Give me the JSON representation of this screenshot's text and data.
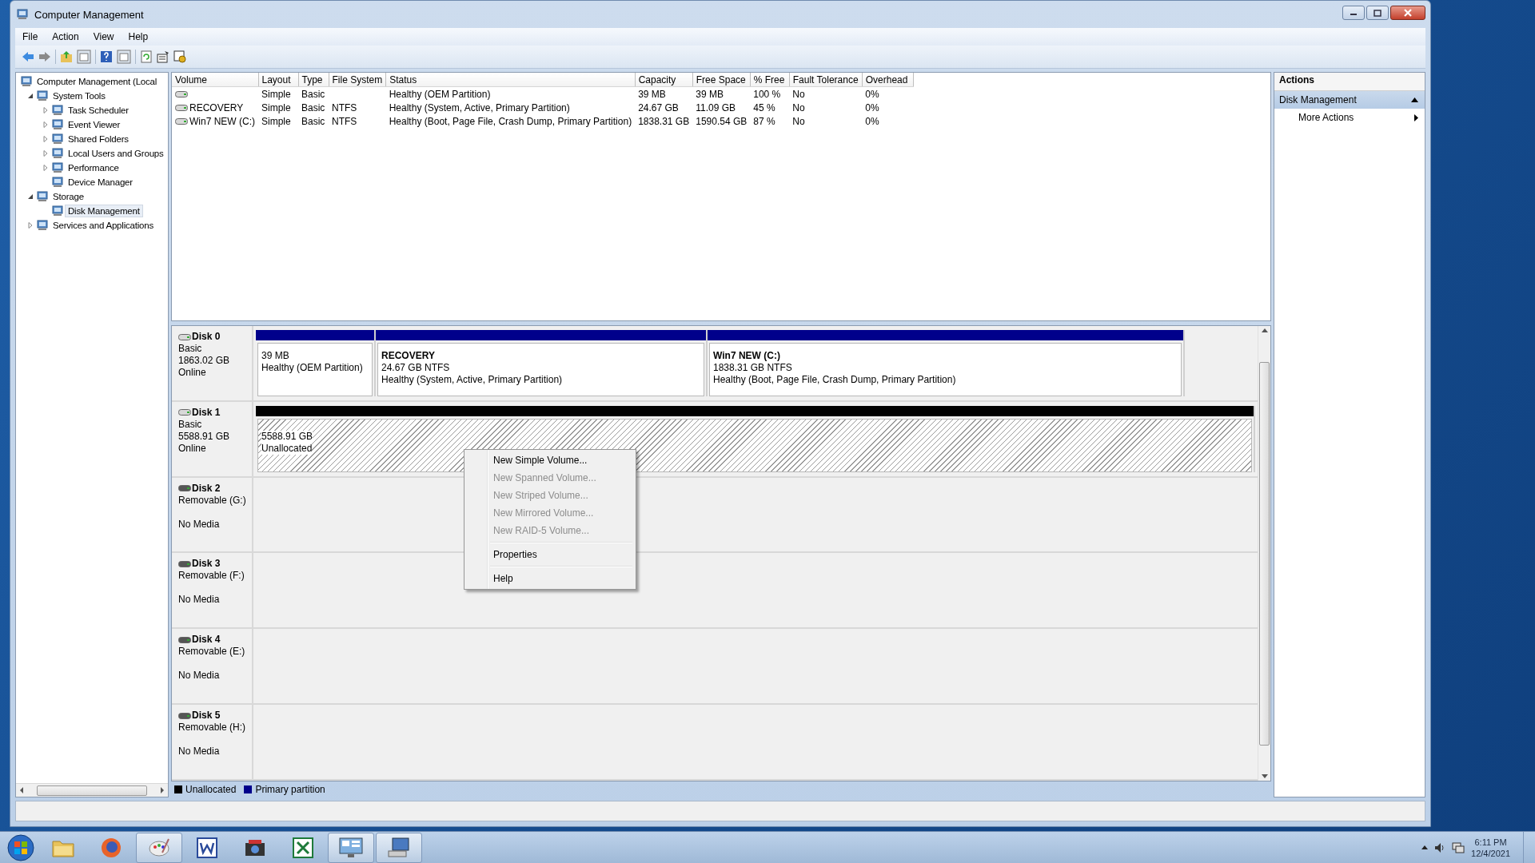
{
  "window": {
    "title": "Computer Management"
  },
  "menu": [
    "File",
    "Action",
    "View",
    "Help"
  ],
  "tree": [
    {
      "label": "Computer Management (Local",
      "selected": false,
      "children": [
        {
          "label": "System Tools",
          "expanded": true,
          "selected": false,
          "children": [
            {
              "label": "Task Scheduler",
              "expanded": false,
              "selected": false
            },
            {
              "label": "Event Viewer",
              "expanded": false,
              "selected": false
            },
            {
              "label": "Shared Folders",
              "expanded": false,
              "selected": false
            },
            {
              "label": "Local Users and Groups",
              "expanded": false,
              "selected": false
            },
            {
              "label": "Performance",
              "expanded": false,
              "selected": false
            },
            {
              "label": "Device Manager",
              "selected": false
            }
          ]
        },
        {
          "label": "Storage",
          "expanded": true,
          "selected": false,
          "children": [
            {
              "label": "Disk Management",
              "selected": true
            }
          ]
        },
        {
          "label": "Services and Applications",
          "expanded": false,
          "selected": false
        }
      ]
    }
  ],
  "table": {
    "columns": [
      "Volume",
      "Layout",
      "Type",
      "File System",
      "Status",
      "Capacity",
      "Free Space",
      "% Free",
      "Fault Tolerance",
      "Overhead"
    ],
    "rows": [
      {
        "layout": "Simple",
        "type": "Basic",
        "status": "Healthy (OEM Partition)",
        "capacity": "39 MB",
        "free_space": "39 MB",
        "percent_free": "100 %",
        "fault_tolerance": "No",
        "overhead": "0%"
      },
      {
        "volume": "RECOVERY",
        "layout": "Simple",
        "type": "Basic",
        "file_system": "NTFS",
        "status": "Healthy (System, Active, Primary Partition)",
        "capacity": "24.67 GB",
        "free_space": "11.09 GB",
        "percent_free": "45 %",
        "fault_tolerance": "No",
        "overhead": "0%"
      },
      {
        "volume": "Win7 NEW (C:)",
        "layout": "Simple",
        "type": "Basic",
        "file_system": "NTFS",
        "status": "Healthy (Boot, Page File, Crash Dump, Primary Partition)",
        "capacity": "1838.31 GB",
        "free_space": "1590.54 GB",
        "percent_free": "87 %",
        "fault_tolerance": "No",
        "overhead": "0%"
      }
    ]
  },
  "disks": [
    {
      "kind": "fixed",
      "name": "Disk 0",
      "type": "Basic",
      "size": "1863.02 GB",
      "status": "Online",
      "partitions": [
        {
          "kind": "primary",
          "size": "39 MB",
          "status": "Healthy (OEM Partition)"
        },
        {
          "kind": "primary",
          "label": "RECOVERY",
          "size": "24.67 GB NTFS",
          "status": "Healthy (System, Active, Primary Partition)"
        },
        {
          "kind": "primary",
          "label": "Win7 NEW  (C:)",
          "size": "1838.31 GB NTFS",
          "status": "Healthy (Boot, Page File, Crash Dump, Primary Partition)"
        }
      ]
    },
    {
      "kind": "fixed",
      "name": "Disk 1",
      "type": "Basic",
      "size": "5588.91 GB",
      "status": "Online",
      "partitions": [
        {
          "kind": "unallocated",
          "size": "5588.91 GB",
          "status": "Unallocated"
        }
      ]
    },
    {
      "kind": "removable",
      "name": "Disk 2",
      "type": "Removable (G:)",
      "status": "No Media"
    },
    {
      "kind": "removable",
      "name": "Disk 3",
      "type": "Removable (F:)",
      "status": "No Media"
    },
    {
      "kind": "removable",
      "name": "Disk 4",
      "type": "Removable (E:)",
      "status": "No Media"
    },
    {
      "kind": "removable",
      "name": "Disk 5",
      "type": "Removable (H:)",
      "status": "No Media"
    }
  ],
  "legend": [
    {
      "label": "Unallocated",
      "color": "#000000"
    },
    {
      "label": "Primary partition",
      "color": "#00008b"
    }
  ],
  "actions": {
    "title": "Actions",
    "section": "Disk Management",
    "items": [
      "More Actions"
    ]
  },
  "context_menu": [
    {
      "kind": "item",
      "label": "New Simple Volume...",
      "disabled": false
    },
    {
      "kind": "item",
      "label": "New Spanned Volume...",
      "disabled": true
    },
    {
      "kind": "item",
      "label": "New Striped Volume...",
      "disabled": true
    },
    {
      "kind": "item",
      "label": "New Mirrored Volume...",
      "disabled": true
    },
    {
      "kind": "item",
      "label": "New RAID-5 Volume...",
      "disabled": true
    },
    {
      "kind": "separator"
    },
    {
      "kind": "item",
      "label": "Properties",
      "disabled": false
    },
    {
      "kind": "separator"
    },
    {
      "kind": "item",
      "label": "Help",
      "disabled": false
    }
  ],
  "taskbar": {
    "apps": [
      {
        "kind": "folder",
        "active": false
      },
      {
        "kind": "browser",
        "active": false
      },
      {
        "kind": "paint",
        "active": true
      },
      {
        "kind": "word",
        "active": false
      },
      {
        "kind": "camera",
        "active": false
      },
      {
        "kind": "excel",
        "active": false
      },
      {
        "kind": "panel",
        "active": true
      },
      {
        "kind": "computer",
        "active": true
      }
    ],
    "time": "6:11 PM",
    "date": "12/4/2021"
  }
}
